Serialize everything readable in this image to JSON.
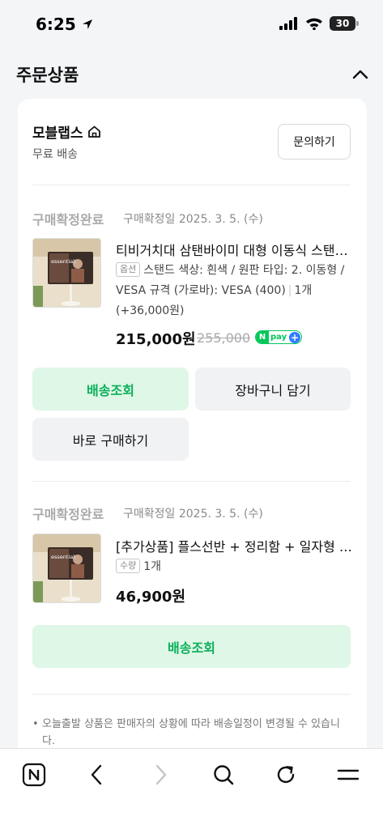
{
  "status_bar": {
    "time": "6:25",
    "battery": "30"
  },
  "section": {
    "title": "주문상품"
  },
  "seller": {
    "name": "모블랩스",
    "shipping": "무료 배송",
    "inquiry_label": "문의하기"
  },
  "items": [
    {
      "status": "구매확정완료",
      "confirm_date": "구매확정일 2025. 3. 5. (수)",
      "thumb_brand": "essential:",
      "name": "티비거치대 삼탠바이미 대형 이동식 스탠드 무선 자가 배송",
      "option_tag": "옵션",
      "option_text": "스탠드 색상: 흰색 / 원판 타입: 2. 이동형 / VESA 규격 (가로바): VESA (400)",
      "quantity": "1개 (+36,000원)",
      "price": "215,000원",
      "original_price": "255,000",
      "npay_n": "N",
      "npay_text": "pay",
      "npay_plus": "+",
      "buttons": {
        "track": "배송조회",
        "cart": "장바구니 담기",
        "buy_now": "바로 구매하기"
      }
    },
    {
      "status": "구매확정완료",
      "confirm_date": "구매확정일 2025. 3. 5. (수)",
      "thumb_brand": "essential:",
      "name": "[추가상품] 플스선반 + 정리함 + 일자형 리모컨 거치대",
      "option_tag": "수량",
      "quantity": "1개",
      "price": "46,900원",
      "buttons": {
        "track": "배송조회"
      }
    }
  ],
  "notice": "오늘출발 상품은 판매자의 상황에 따라 배송일정이 변경될 수 있습니다.",
  "colors": {
    "accent_green": "#0ab05a",
    "green_bg": "#dff7e6",
    "npay_green": "#03c75a",
    "npay_blue": "#2f7cff"
  }
}
